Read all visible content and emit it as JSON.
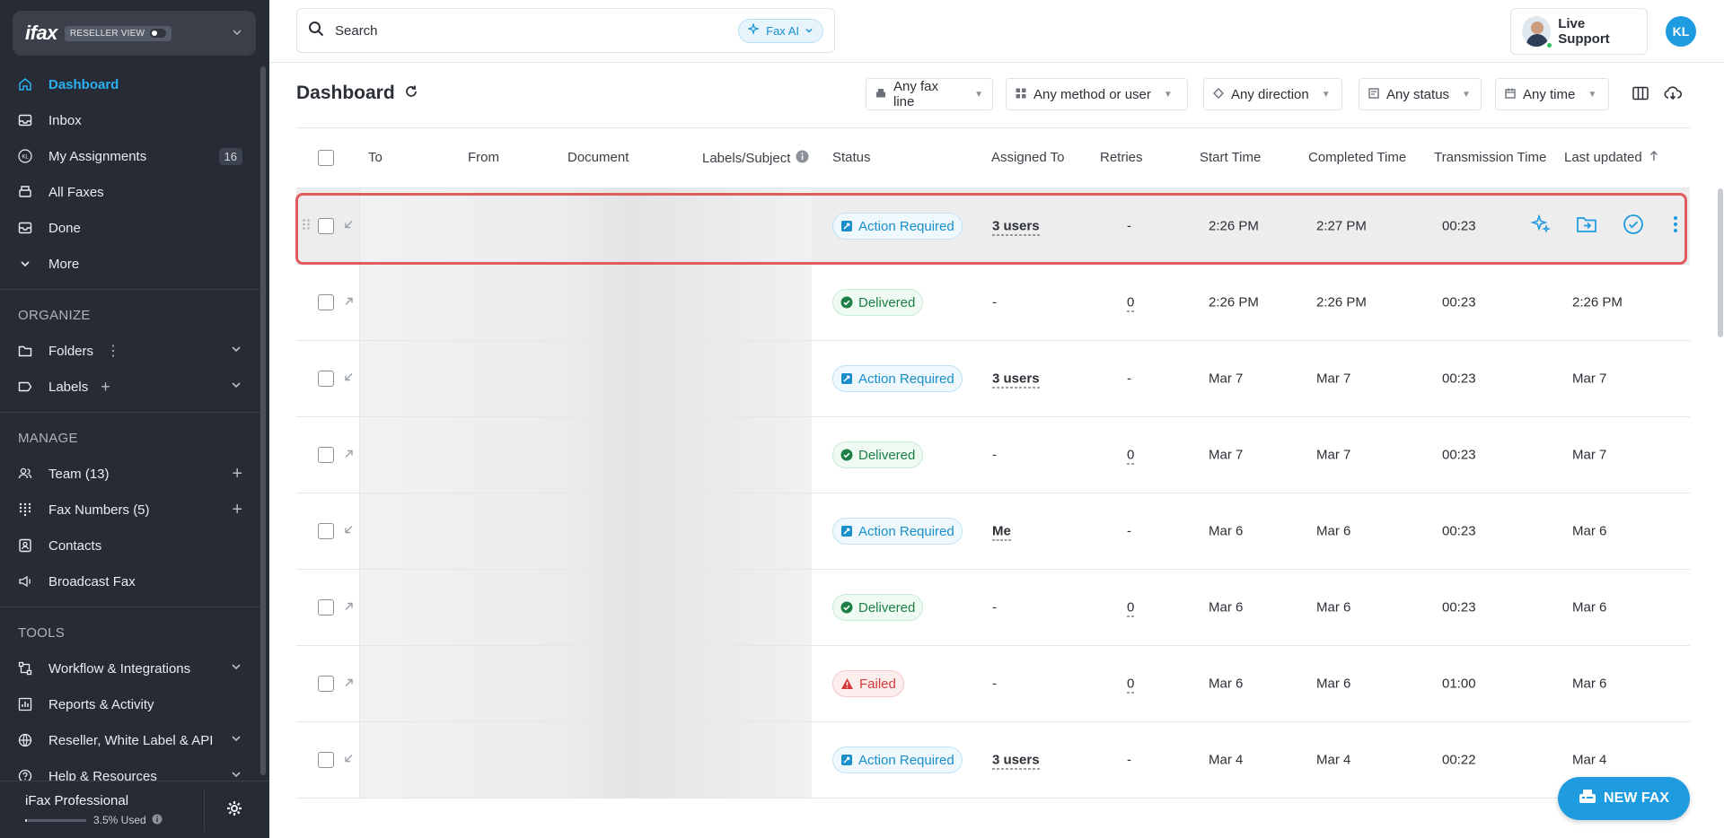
{
  "sidebar": {
    "logo": "ifax",
    "reseller_label": "RESELLER VIEW",
    "nav": [
      {
        "label": "Dashboard",
        "icon": "home-icon",
        "active": true
      },
      {
        "label": "Inbox",
        "icon": "inbox-icon"
      },
      {
        "label": "My Assignments",
        "icon": "kl-icon",
        "badge": "16"
      },
      {
        "label": "All Faxes",
        "icon": "fax-icon"
      },
      {
        "label": "Done",
        "icon": "done-icon"
      },
      {
        "label": "More",
        "icon": "chevron-down-icon"
      }
    ],
    "organize_label": "ORGANIZE",
    "organize": [
      {
        "label": "Folders"
      },
      {
        "label": "Labels"
      }
    ],
    "manage_label": "MANAGE",
    "manage": [
      {
        "label": "Team (13)"
      },
      {
        "label": "Fax Numbers (5)"
      },
      {
        "label": "Contacts"
      },
      {
        "label": "Broadcast Fax"
      }
    ],
    "tools_label": "TOOLS",
    "tools": [
      {
        "label": "Workflow & Integrations"
      },
      {
        "label": "Reports & Activity"
      },
      {
        "label": "Reseller, White Label & API"
      },
      {
        "label": "Help & Resources"
      }
    ],
    "plan": {
      "name": "iFax Professional",
      "usage": "3.5% Used",
      "usage_fraction": 0.035
    }
  },
  "topbar": {
    "search_placeholder": "Search",
    "faxai_label": "Fax AI",
    "support_label": "Live Support",
    "user_initials": "KL"
  },
  "dashboard": {
    "title": "Dashboard",
    "filters": [
      "Any fax line",
      "Any method or user",
      "Any direction",
      "Any status",
      "Any time"
    ]
  },
  "table": {
    "columns": [
      "To",
      "From",
      "Document",
      "Labels/Subject",
      "Status",
      "Assigned To",
      "Retries",
      "Start Time",
      "Completed Time",
      "Transmission Time",
      "Last updated"
    ],
    "rows": [
      {
        "status": "Action Required",
        "kind": "action",
        "assigned": "3 users",
        "retries": "-",
        "start": "2:26 PM",
        "completed": "2:27 PM",
        "transmission": "00:23",
        "updated": "",
        "direction": "in"
      },
      {
        "status": "Delivered",
        "kind": "deliv",
        "assigned": "-",
        "retries": "0",
        "start": "2:26 PM",
        "completed": "2:26 PM",
        "transmission": "00:23",
        "updated": "2:26 PM",
        "direction": "out"
      },
      {
        "status": "Action Required",
        "kind": "action",
        "assigned": "3 users",
        "retries": "-",
        "start": "Mar 7",
        "completed": "Mar 7",
        "transmission": "00:23",
        "updated": "Mar 7",
        "direction": "in"
      },
      {
        "status": "Delivered",
        "kind": "deliv",
        "assigned": "-",
        "retries": "0",
        "start": "Mar 7",
        "completed": "Mar 7",
        "transmission": "00:23",
        "updated": "Mar 7",
        "direction": "out"
      },
      {
        "status": "Action Required",
        "kind": "action",
        "assigned": "Me",
        "retries": "-",
        "start": "Mar 6",
        "completed": "Mar 6",
        "transmission": "00:23",
        "updated": "Mar 6",
        "direction": "in"
      },
      {
        "status": "Delivered",
        "kind": "deliv",
        "assigned": "-",
        "retries": "0",
        "start": "Mar 6",
        "completed": "Mar 6",
        "transmission": "00:23",
        "updated": "Mar 6",
        "direction": "out"
      },
      {
        "status": "Failed",
        "kind": "fail",
        "assigned": "-",
        "retries": "0",
        "start": "Mar 6",
        "completed": "Mar 6",
        "transmission": "01:00",
        "updated": "Mar 6",
        "direction": "out"
      },
      {
        "status": "Action Required",
        "kind": "action",
        "assigned": "3 users",
        "retries": "-",
        "start": "Mar 4",
        "completed": "Mar 4",
        "transmission": "00:22",
        "updated": "Mar 4",
        "direction": "in"
      }
    ]
  },
  "new_fax_label": "NEW FAX",
  "colors": {
    "accent": "#1f9be0",
    "sidebar_bg": "#262b36",
    "highlight": "#e25c5c"
  }
}
